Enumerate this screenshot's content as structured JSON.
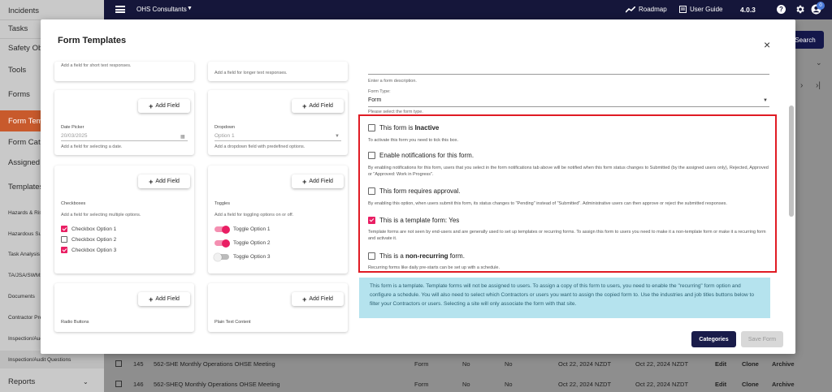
{
  "sidebar": {
    "items": [
      {
        "label": "Incidents"
      },
      {
        "label": "Tasks"
      },
      {
        "label": "Safety Obs"
      },
      {
        "label": "Tools"
      },
      {
        "label": "Forms"
      },
      {
        "label": "Form Temp"
      },
      {
        "label": "Form Cate"
      },
      {
        "label": "Assigned F"
      },
      {
        "label": "Templates"
      },
      {
        "label": "Hazards & Risk"
      },
      {
        "label": "Hazardous Sub"
      },
      {
        "label": "Task Analysis I"
      },
      {
        "label": "TA/JSA/SWMS"
      },
      {
        "label": "Documents"
      },
      {
        "label": "Contractor Pre-"
      },
      {
        "label": "Inspection/Audit"
      },
      {
        "label": "Inspection/Audit Questions"
      },
      {
        "label": "Reports"
      }
    ]
  },
  "topbar": {
    "org": "OHS Consultants",
    "roadmap": "Roadmap",
    "user_guide": "User Guide",
    "version": "4.0.3",
    "badge": "0",
    "help_glyph": "?",
    "icons": [
      "menu-icon",
      "chevron-down-icon",
      "roadmap-icon",
      "user-guide-icon",
      "help-icon",
      "gear-icon",
      "account-icon"
    ]
  },
  "background": {
    "search_label": "Search",
    "rows": [
      {
        "num": "145",
        "name": "562-SHE Monthly Operations OHSE Meeting",
        "type": "Form",
        "c1": "No",
        "c2": "No",
        "created": "Oct 22, 2024 NZDT",
        "updated": "Oct 22, 2024 NZDT",
        "edit": "Edit",
        "clone": "Clone",
        "archive": "Archive"
      },
      {
        "num": "146",
        "name": "562-SHEQ Monthly Operations OHSE Meeting",
        "type": "Form",
        "c1": "No",
        "c2": "No",
        "created": "Oct 22, 2024 NZDT",
        "updated": "Oct 22, 2024 NZDT",
        "edit": "Edit",
        "clone": "Clone",
        "archive": "Archive"
      }
    ]
  },
  "modal": {
    "title": "Form Templates",
    "close_glyph": "×",
    "add_field": "Add Field",
    "cards": {
      "short_text_desc": "Add a field for short text responses.",
      "long_text_desc": "Add a field for longer text responses.",
      "date_picker": {
        "title": "Date Picker",
        "value": "20/03/2025",
        "desc": "Add a field for selecting a date."
      },
      "dropdown": {
        "title": "Dropdown",
        "value": "Option 1",
        "desc": "Add a dropdown field with predefined options."
      },
      "checkboxes": {
        "title": "Checkboxes",
        "desc": "Add a field for selecting multiple options.",
        "options": [
          {
            "label": "Checkbox Option 1",
            "checked": true
          },
          {
            "label": "Checkbox Option 2",
            "checked": false
          },
          {
            "label": "Checkbox Option 3",
            "checked": true
          }
        ]
      },
      "toggles": {
        "title": "Toggles",
        "desc": "Add a field for toggling options on or off.",
        "options": [
          {
            "label": "Toggle Option 1",
            "on": true
          },
          {
            "label": "Toggle Option 2",
            "on": true
          },
          {
            "label": "Toggle Option 3",
            "on": false
          }
        ]
      },
      "radio_buttons": {
        "title": "Radio Buttons"
      },
      "plain_text": {
        "title": "Plain Text Content"
      }
    },
    "form": {
      "description_helper": "Enter a form description.",
      "form_type_label": "Form Type:",
      "form_type_value": "Form",
      "form_type_helper": "Please select the form type.",
      "options": [
        {
          "label_pre": "This form is ",
          "label_bold": "Inactive",
          "label_post": "",
          "checked": false,
          "desc": "To activate this form you need to tick this box."
        },
        {
          "label_pre": "Enable notifications for this form.",
          "label_bold": "",
          "label_post": "",
          "checked": false,
          "desc": "By enabling notifications for this form, users that you select in the form notifications tab above will be notified when this form status changes to Submitted (by the assigned users only), Rejected, Approved or \"Approved: Work in Progress\"."
        },
        {
          "label_pre": "This form requires approval.",
          "label_bold": "",
          "label_post": "",
          "checked": false,
          "desc": "By enabling this option, when users submit this form, its status changes to \"Pending\" instead of \"Submitted\". Administrative users can then approve or reject the submitted responses."
        },
        {
          "label_pre": "This is a template form: Yes",
          "label_bold": "",
          "label_post": "",
          "checked": true,
          "desc": "Template forms are not seen by end-users and are generally used to set up templates or recurring forms. To assign this form to users you need to make it a non-template form or make it a recurring form and activate it."
        },
        {
          "label_pre": "This is a ",
          "label_bold": "non-recurring",
          "label_post": " form.",
          "checked": false,
          "desc": "Recurring forms like daily pre-starts can be set up with a schedule."
        }
      ],
      "info": "This form is a template. Template forms will not be assigned to users. To assign a copy of this form to users, you need to enable the \"recurring\" form option and configure a schedule. You will also need to select which Contractors or users you want to assign the copied form to. Use the industries and job titles buttons below to filter your Contractors or users. Selecting a site will only associate the form with that site."
    },
    "buttons": {
      "categories": "Categories",
      "save": "Save Form"
    }
  },
  "colors": {
    "topbar": "#15163a",
    "active_nav": "#c85a2c",
    "accent_pink": "#e91e63",
    "highlight_red": "#e01b24",
    "info_bg": "#b5e3ee"
  }
}
